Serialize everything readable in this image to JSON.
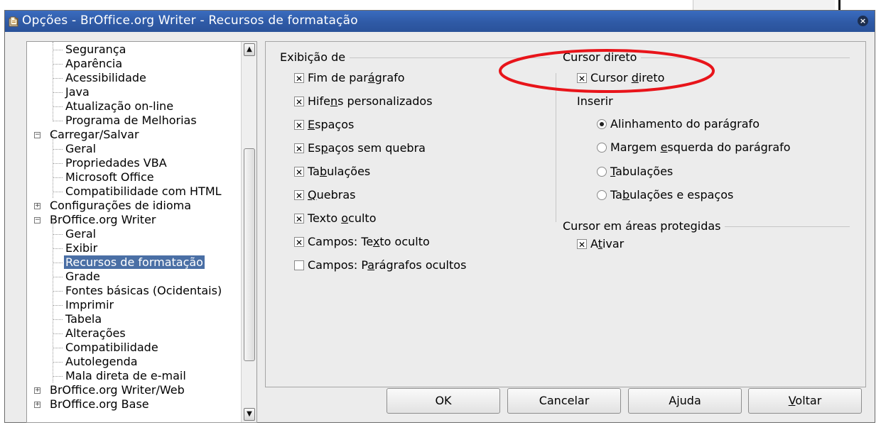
{
  "window": {
    "title": "Opções - BrOffice.org Writer - Recursos de formatação",
    "close_label": "×"
  },
  "tree": {
    "items": [
      {
        "label": "Segurança",
        "level": 2,
        "expander": ""
      },
      {
        "label": "Aparência",
        "level": 2,
        "expander": ""
      },
      {
        "label": "Acessibilidade",
        "level": 2,
        "expander": ""
      },
      {
        "label": "Java",
        "level": 2,
        "expander": ""
      },
      {
        "label": "Atualização on-line",
        "level": 2,
        "expander": ""
      },
      {
        "label": "Programa de Melhorias",
        "level": 2,
        "expander": ""
      },
      {
        "label": "Carregar/Salvar",
        "level": 1,
        "expander": "−"
      },
      {
        "label": "Geral",
        "level": 2,
        "expander": ""
      },
      {
        "label": "Propriedades VBA",
        "level": 2,
        "expander": ""
      },
      {
        "label": "Microsoft Office",
        "level": 2,
        "expander": ""
      },
      {
        "label": "Compatibilidade com HTML",
        "level": 2,
        "expander": ""
      },
      {
        "label": "Configurações de idioma",
        "level": 1,
        "expander": "+"
      },
      {
        "label": "BrOffice.org Writer",
        "level": 1,
        "expander": "−"
      },
      {
        "label": "Geral",
        "level": 2,
        "expander": ""
      },
      {
        "label": "Exibir",
        "level": 2,
        "expander": ""
      },
      {
        "label": "Recursos de formatação",
        "level": 2,
        "expander": "",
        "selected": true
      },
      {
        "label": "Grade",
        "level": 2,
        "expander": ""
      },
      {
        "label": "Fontes básicas (Ocidentais)",
        "level": 2,
        "expander": ""
      },
      {
        "label": "Imprimir",
        "level": 2,
        "expander": ""
      },
      {
        "label": "Tabela",
        "level": 2,
        "expander": ""
      },
      {
        "label": "Alterações",
        "level": 2,
        "expander": ""
      },
      {
        "label": "Compatibilidade",
        "level": 2,
        "expander": ""
      },
      {
        "label": "Autolegenda",
        "level": 2,
        "expander": ""
      },
      {
        "label": "Mala direta de e-mail",
        "level": 2,
        "expander": ""
      },
      {
        "label": "BrOffice.org Writer/Web",
        "level": 1,
        "expander": "+"
      },
      {
        "label": "BrOffice.org Base",
        "level": 1,
        "expander": "+"
      }
    ],
    "scroll_up": "▲",
    "scroll_down": "▼"
  },
  "exibicao": {
    "title": "Exibição de",
    "items": [
      {
        "before": "Fim de par",
        "key": "á",
        "after": "grafo",
        "checked": true
      },
      {
        "before": "Hife",
        "key": "n",
        "after": "s personalizados",
        "checked": true
      },
      {
        "before": "",
        "key": "E",
        "after": "spaços",
        "checked": true
      },
      {
        "before": "Es",
        "key": "p",
        "after": "aços sem quebra",
        "checked": true
      },
      {
        "before": "Ta",
        "key": "b",
        "after": "ulações",
        "checked": true
      },
      {
        "before": "",
        "key": "Q",
        "after": "uebras",
        "checked": true
      },
      {
        "before": "Texto ",
        "key": "o",
        "after": "culto",
        "checked": true
      },
      {
        "before": "Campos: Te",
        "key": "x",
        "after": "to oculto",
        "checked": true
      },
      {
        "before": "Campos: P",
        "key": "a",
        "after": "rágrafos ocultos",
        "checked": false
      }
    ]
  },
  "cursor_direto": {
    "title": "Cursor direto",
    "check": {
      "before": "Cursor ",
      "key": "d",
      "after": "ireto",
      "checked": true
    },
    "inserir_label": "Inserir",
    "radios": [
      {
        "before": "Alinhamento do pará",
        "key": "g",
        "after": "rafo",
        "selected": true
      },
      {
        "before": "Margem ",
        "key": "e",
        "after": "squerda do parágrafo",
        "selected": false
      },
      {
        "before": "",
        "key": "T",
        "after": "abulações",
        "selected": false
      },
      {
        "before": "Ta",
        "key": "b",
        "after": "ulações e espaços",
        "selected": false
      }
    ]
  },
  "protegidas": {
    "title": "Cursor em áreas protegidas",
    "check": {
      "before": "A",
      "key": "t",
      "after": "ivar",
      "checked": true
    }
  },
  "buttons": {
    "ok": {
      "before": "OK",
      "key": "",
      "after": ""
    },
    "cancel": {
      "before": "Cancelar",
      "key": "",
      "after": ""
    },
    "help": {
      "before": "A",
      "key": "j",
      "after": "uda"
    },
    "back": {
      "before": "",
      "key": "V",
      "after": "oltar"
    }
  },
  "colors": {
    "titlebar": "#2f5aa6",
    "selection": "#4a6fa5",
    "annotation": "#e8141a"
  }
}
